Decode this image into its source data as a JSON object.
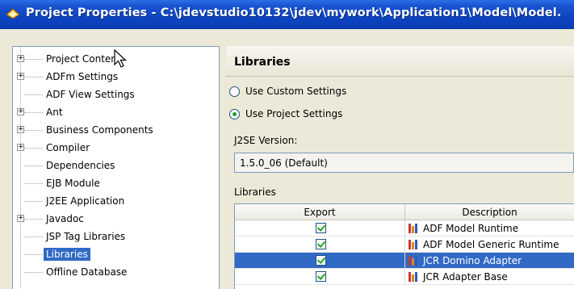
{
  "window": {
    "title": "Project Properties - C:\\jdevstudio10132\\jdev\\mywork\\Application1\\Model\\Model."
  },
  "tree": {
    "items": [
      {
        "label": "Project Content",
        "expandable": true
      },
      {
        "label": "ADFm Settings",
        "expandable": true
      },
      {
        "label": "ADF View Settings",
        "expandable": false
      },
      {
        "label": "Ant",
        "expandable": true
      },
      {
        "label": "Business Components",
        "expandable": true
      },
      {
        "label": "Compiler",
        "expandable": true
      },
      {
        "label": "Dependencies",
        "expandable": false
      },
      {
        "label": "EJB Module",
        "expandable": false
      },
      {
        "label": "J2EE Application",
        "expandable": false
      },
      {
        "label": "Javadoc",
        "expandable": true
      },
      {
        "label": "JSP Tag Libraries",
        "expandable": false
      },
      {
        "label": "Libraries",
        "expandable": false,
        "selected": true
      },
      {
        "label": "Offline Database",
        "expandable": false
      }
    ]
  },
  "panel": {
    "heading": "Libraries",
    "radio_custom": "Use Custom Settings",
    "radio_project": "Use Project Settings",
    "selected_radio": "Use Project Settings",
    "j2se_label": "J2SE Version:",
    "j2se_value": "1.5.0_06 (Default)",
    "libraries_label": "Libraries"
  },
  "table": {
    "headers": [
      "Export",
      "Description"
    ],
    "rows": [
      {
        "export": true,
        "description": "ADF Model Runtime",
        "selected": false
      },
      {
        "export": true,
        "description": "ADF Model Generic Runtime",
        "selected": false
      },
      {
        "export": true,
        "description": "JCR Domino Adapter",
        "selected": true
      },
      {
        "export": true,
        "description": "JCR Adapter Base",
        "selected": false
      }
    ]
  },
  "colors": {
    "titlebar": "#0d44c2",
    "selection": "#316ac5",
    "check": "#21a121"
  }
}
